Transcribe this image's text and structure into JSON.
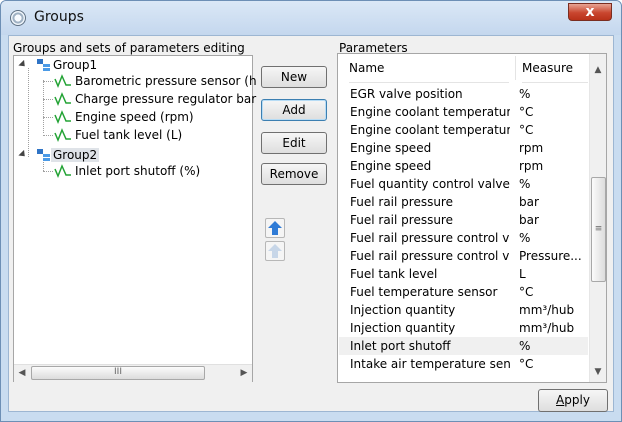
{
  "window": {
    "title": "Groups",
    "close_label": "x"
  },
  "left_panel": {
    "label": "Groups and sets of parameters editing",
    "groups": [
      {
        "label": "Group1",
        "items": [
          "Barometric pressure sensor (h",
          "Charge pressure regulator bar",
          "Engine speed (rpm)",
          "Fuel tank level (L)"
        ]
      },
      {
        "label": "Group2",
        "items": [
          "Inlet port shutoff (%)"
        ]
      }
    ],
    "scroll_thumb_grip": "III"
  },
  "buttons": {
    "new": "New",
    "add": "Add",
    "edit": "Edit",
    "remove": "Remove",
    "apply_prefix": "",
    "apply_underlined": "A",
    "apply_rest": "pply"
  },
  "parameters": {
    "label": "Parameters",
    "columns": [
      "Name",
      "Measure"
    ],
    "scroll_thumb_grip": "≡",
    "rows": [
      {
        "name": "EGR valve position",
        "measure": "%"
      },
      {
        "name": "Engine coolant temperature ...",
        "measure": "°C"
      },
      {
        "name": "Engine coolant temperature ...",
        "measure": "°C"
      },
      {
        "name": "Engine speed",
        "measure": "rpm"
      },
      {
        "name": "Engine speed",
        "measure": "rpm"
      },
      {
        "name": "Fuel quantity control valve",
        "measure": "%"
      },
      {
        "name": "Fuel rail pressure",
        "measure": "bar"
      },
      {
        "name": "Fuel rail pressure",
        "measure": "bar"
      },
      {
        "name": "Fuel rail pressure control valve",
        "measure": "%"
      },
      {
        "name": "Fuel rail pressure control valve",
        "measure": "Pressure..."
      },
      {
        "name": "Fuel tank level",
        "measure": "L"
      },
      {
        "name": "Fuel temperature sensor",
        "measure": "°C"
      },
      {
        "name": "Injection quantity",
        "measure": "mm³/hub"
      },
      {
        "name": "Injection quantity",
        "measure": "mm³/hub"
      },
      {
        "name": "Inlet port shutoff",
        "measure": "%"
      },
      {
        "name": "Intake air temperature sensor",
        "measure": "°C"
      }
    ],
    "selected_row_index": 14
  },
  "colors": {
    "title_bar": "#c9dcf0",
    "close_button": "#c9462f",
    "move_up_arrow": "#2f7bd6",
    "move_down_arrow": "#c7d6e8",
    "graph_icon": "#23a335"
  },
  "icons": {
    "title": "groups-icon",
    "group": "group-tree-icon",
    "parameter": "graph-icon",
    "move_up": "arrow-up-icon",
    "move_down": "arrow-down-icon"
  }
}
